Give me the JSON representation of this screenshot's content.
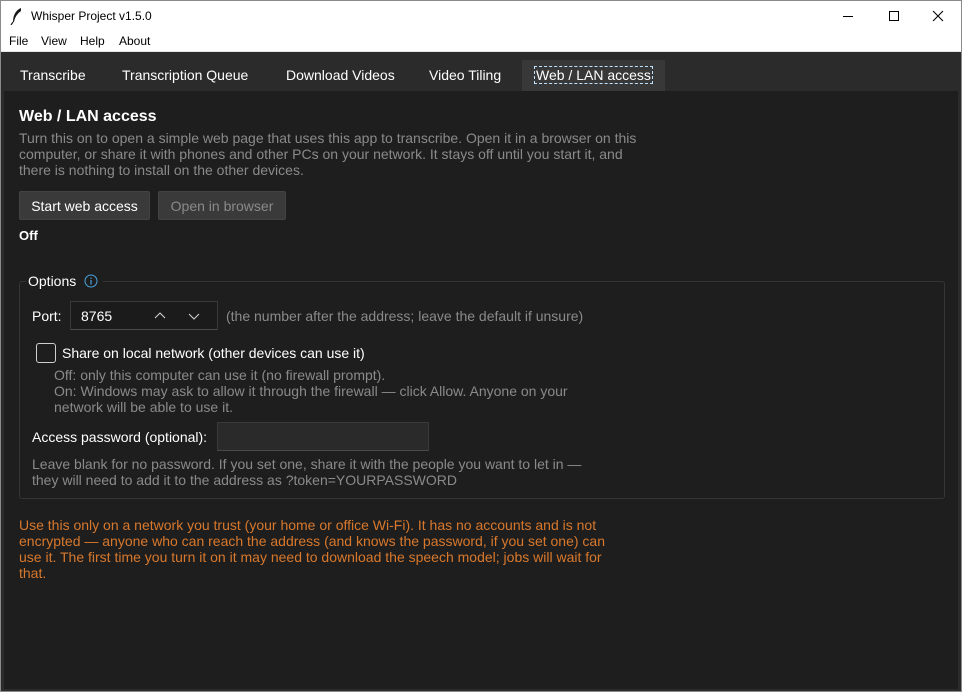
{
  "window": {
    "title": "Whisper Project v1.5.0",
    "icon": "feather-icon",
    "controls": [
      "minimize-icon",
      "maximize-icon",
      "close-icon"
    ]
  },
  "menu": {
    "items": [
      "File",
      "View",
      "Help",
      "About"
    ]
  },
  "tabs": [
    {
      "label": "Transcribe",
      "active": false
    },
    {
      "label": "Transcription Queue",
      "active": false
    },
    {
      "label": "Download Videos",
      "active": false
    },
    {
      "label": "Video Tiling",
      "active": false
    },
    {
      "label": "Web / LAN access",
      "active": true
    }
  ],
  "web_access": {
    "heading": "Web / LAN access",
    "description": "Turn this on to open a simple web page that uses this app to transcribe. Open it in a browser on this computer, or share it with phones and other PCs on your network. It stays off until you start it, and there is nothing to install on the other devices.",
    "start_button": "Start web access",
    "open_button": "Open in browser",
    "open_button_enabled": false,
    "status": "Off",
    "options": {
      "title": "Options",
      "info_icon": "info-icon",
      "port_label": "Port:",
      "port_value": "8765",
      "port_hint": "(the number after the address; leave the default if unsure)",
      "share_label": "Share on local network (other devices can use it)",
      "share_checked": false,
      "share_desc": "Off: only this computer can use it (no firewall prompt).\nOn: Windows may ask to allow it through the firewall — click Allow. Anyone on your network will be able to use it.",
      "password_label": "Access password (optional):",
      "password_value": "",
      "password_desc": "Leave blank for no password. If you set one, share it with the people you want to let in — they will need to add it to the address as  ?token=YOURPASSWORD"
    },
    "warning": "Use this only on a network you trust (your home or office Wi-Fi). It has no accounts and is not encrypted — anyone who can reach the address (and knows the password, if you set one) can use it. The first time you turn it on it may need to download the speech model; jobs will wait for that.",
    "colors": {
      "warning": "#d8782c",
      "muted": "#8a8a8a",
      "info_accent": "#4aa3df"
    }
  }
}
